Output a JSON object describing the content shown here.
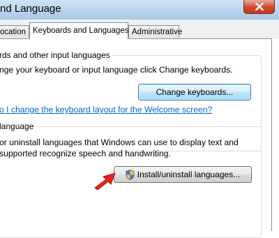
{
  "window": {
    "title": "nd Language"
  },
  "tabs": [
    {
      "label": "Location",
      "active": false
    },
    {
      "label": "Keyboards and Languages",
      "active": true
    },
    {
      "label": "Administrative",
      "active": false
    }
  ],
  "keyboards_group": {
    "legend": "rds and other input languages",
    "description": "nge your keyboard or input language click Change keyboards.",
    "button_label": "Change keyboards...",
    "link_text": "o I change the keyboard layout for the Welcome screen?"
  },
  "display_language_group": {
    "legend": "language",
    "description_line1": "or uninstall languages that Windows can use to display text and",
    "description_line2": "supported recognize speech and handwriting.",
    "button_label": "Install/uninstall languages...",
    "button_icon": "uac-shield-icon"
  },
  "annotation": {
    "arrow_color": "#e8241c"
  }
}
